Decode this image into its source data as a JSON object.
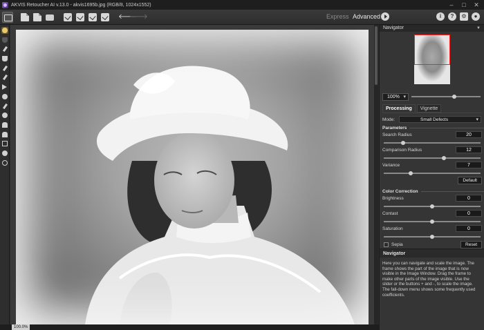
{
  "window": {
    "title": "AKVIS Retoucher AI v.13.0 - akvis1695b.jpg (RGB/8, 1024x1552)",
    "controls": [
      "–",
      "□",
      "✕"
    ]
  },
  "toolbar": {
    "mode_express": "Express",
    "mode_advanced": "Advanced",
    "help_labels": [
      "i",
      "?"
    ]
  },
  "status": {
    "zoom": "100.0%"
  },
  "navigator": {
    "title": "Navigator",
    "zoom": "100%",
    "zoom_slider_level": 0.62
  },
  "tabs": {
    "processing": "Processing",
    "vignette": "Vignette"
  },
  "processing": {
    "mode_label": "Mode:",
    "mode_value": "Small Defects",
    "parameters_heading": "Parameters",
    "search_radius": {
      "label": "Search Radius",
      "value": "20",
      "level": 0.2
    },
    "comparison_radius": {
      "label": "Comparison Radius",
      "value": "12",
      "level": 0.62
    },
    "variance": {
      "label": "Variance",
      "value": "7",
      "level": 0.28
    },
    "default_button": "Default",
    "color_heading": "Color Correction",
    "brightness": {
      "label": "Brightness",
      "value": "0",
      "level": 0.5
    },
    "contrast": {
      "label": "Contast",
      "value": "0",
      "level": 0.5
    },
    "saturation": {
      "label": "Saturation",
      "value": "0",
      "level": 0.5
    },
    "sepia_label": "Sepia",
    "reset_button": "Reset"
  },
  "help": {
    "title": "Navigator",
    "text": "Here you can navigate and scale the image. The frame shows the part of the image that is now visible in the Image Window. Drag the frame to make other parts of the image visible. Use the slider or the buttons + and -, to scale the image. The fall-down menu shows some frequently used coefficients."
  },
  "colors": {
    "nav_frame": "#ff2020",
    "background": "#2b2b2b",
    "panel": "#353535"
  }
}
